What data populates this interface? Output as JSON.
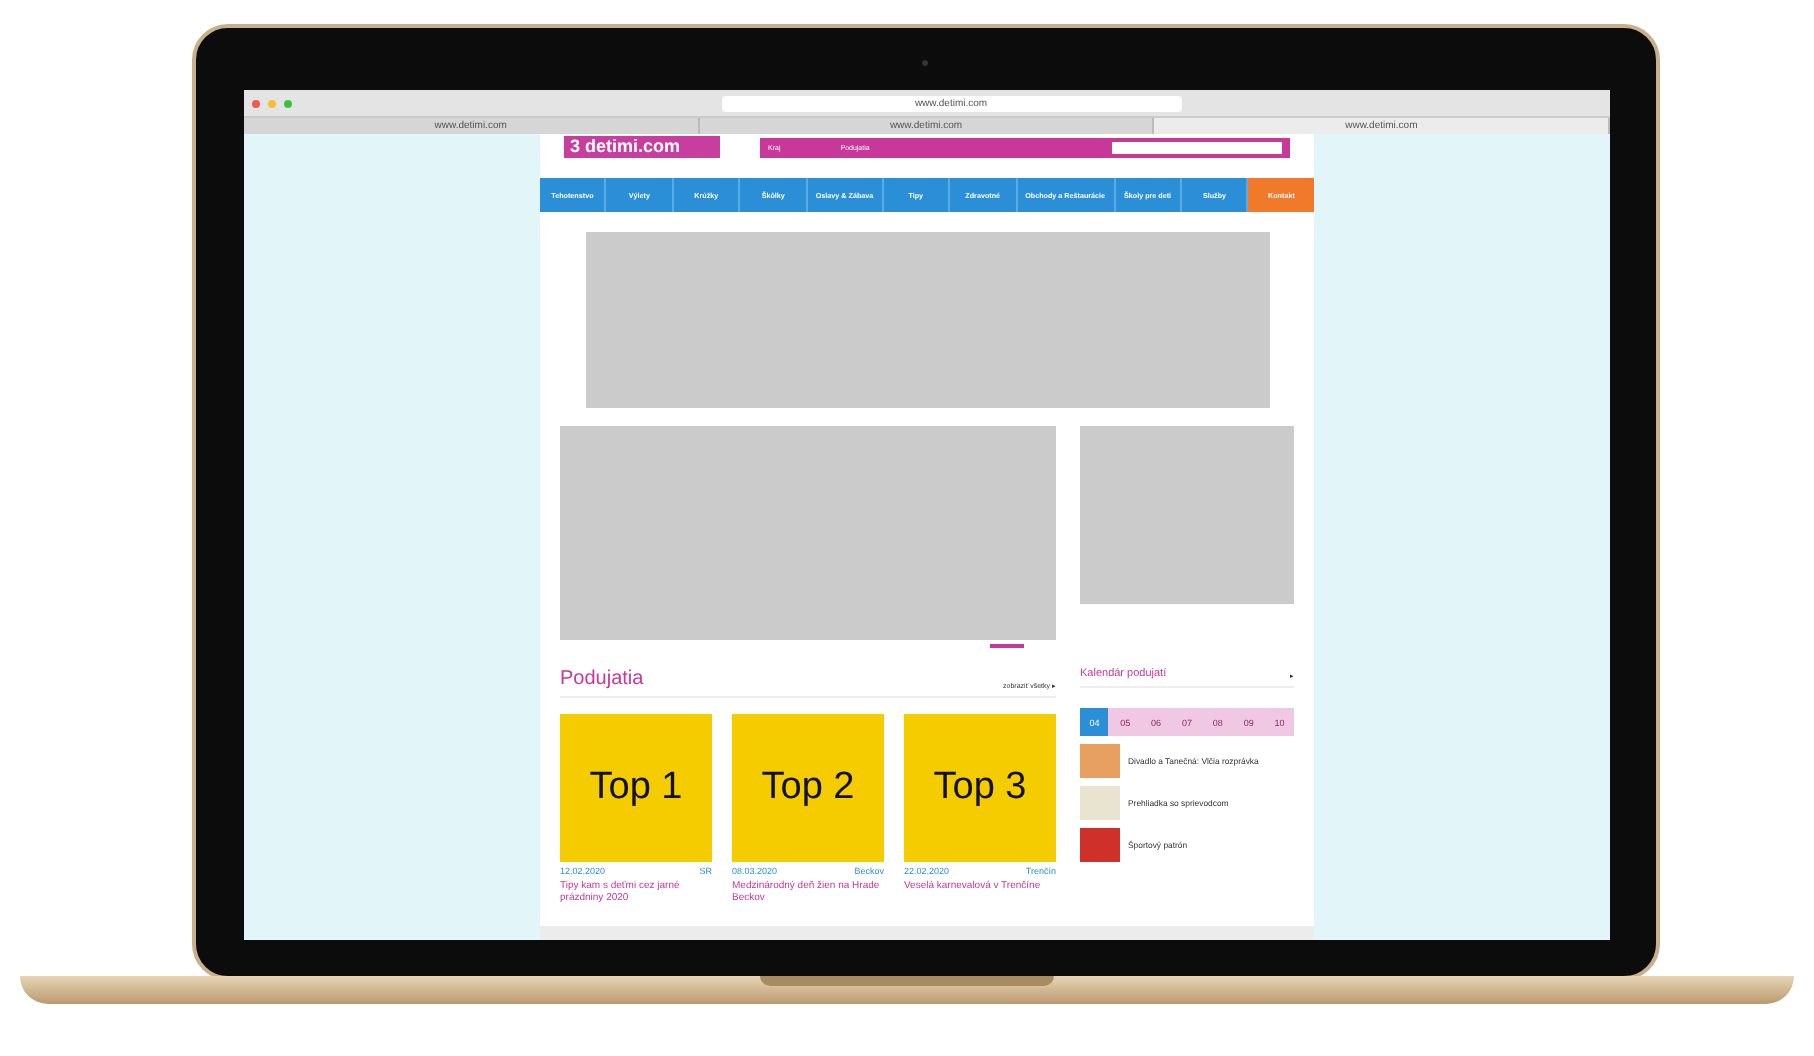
{
  "browser": {
    "address": "www.detimi.com",
    "tabs": [
      {
        "label": "www.detimi.com",
        "selected": false
      },
      {
        "label": "www.detimi.com",
        "selected": false
      },
      {
        "label": "www.detimi.com",
        "selected": true
      }
    ]
  },
  "header": {
    "logo": "3 detimi.com",
    "bar_left": "Kraj",
    "bar_mid": "Podujatia"
  },
  "nav": [
    {
      "label": "Tehotenstvo",
      "kind": "link"
    },
    {
      "label": "Výlety",
      "kind": "link"
    },
    {
      "label": "Krúžky",
      "kind": "link"
    },
    {
      "label": "Škôlky",
      "kind": "link"
    },
    {
      "label": "Oslavy & Zábava",
      "kind": "link"
    },
    {
      "label": "Tipy",
      "kind": "link"
    },
    {
      "label": "Zdravotné",
      "kind": "link"
    },
    {
      "label": "Obchody a Reštaurácie",
      "kind": "link"
    },
    {
      "label": "Školy pre deti",
      "kind": "link"
    },
    {
      "label": "Služby",
      "kind": "link"
    },
    {
      "label": "Kontakt",
      "kind": "cta"
    }
  ],
  "events": {
    "title": "Podujatia",
    "more": "zobraziť všetky ▸",
    "cards": [
      {
        "image": "Top 1",
        "date": "12.02.2020",
        "place": "SR",
        "title": "Tipy kam s deťmi cez jarné prázdniny 2020"
      },
      {
        "image": "Top 2",
        "date": "08.03.2020",
        "place": "Beckov",
        "title": "Medzinárodný deň žien na Hrade Beckov"
      },
      {
        "image": "Top 3",
        "date": "22.02.2020",
        "place": "Trenčín",
        "title": "Veselá karnevalová v Trenčíne"
      }
    ]
  },
  "calendar": {
    "title": "Kalendár podujatí",
    "arrow": "▸",
    "days": [
      {
        "day": "04",
        "selected": true
      },
      {
        "day": "05",
        "selected": false
      },
      {
        "day": "06",
        "selected": false
      },
      {
        "day": "07",
        "selected": false
      },
      {
        "day": "08",
        "selected": false
      },
      {
        "day": "09",
        "selected": false
      },
      {
        "day": "10",
        "selected": false
      }
    ],
    "items": [
      {
        "title": "Divadlo a Tanečná: Vlčia rozprávka",
        "color": "#e8a060"
      },
      {
        "title": "Prehliadka so sprievodcom",
        "color": "#e8e4d0"
      },
      {
        "title": "Športový patrón",
        "color": "#d0302a"
      }
    ]
  }
}
